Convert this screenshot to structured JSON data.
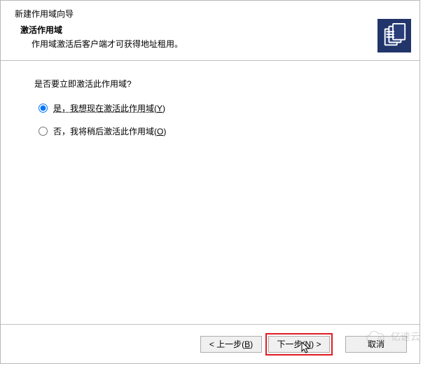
{
  "header": {
    "window_title": "新建作用域向导",
    "section_title": "激活作用域",
    "description": "作用域激活后客户端才可获得地址租用。"
  },
  "body": {
    "question": "是否要立即激活此作用域?",
    "option_yes_prefix": "是，我想现在激活此作用域(",
    "option_yes_key": "Y",
    "option_yes_suffix": ")",
    "option_no_prefix": "否，我将稍后激活此作用域(",
    "option_no_key": "O",
    "option_no_suffix": ")"
  },
  "footer": {
    "back_prefix": "< 上一步(",
    "back_key": "B",
    "back_suffix": ")",
    "next_prefix": "下一步(",
    "next_key": "N",
    "next_suffix": ") >",
    "cancel": "取消"
  },
  "watermark": {
    "text": "亿速云"
  }
}
